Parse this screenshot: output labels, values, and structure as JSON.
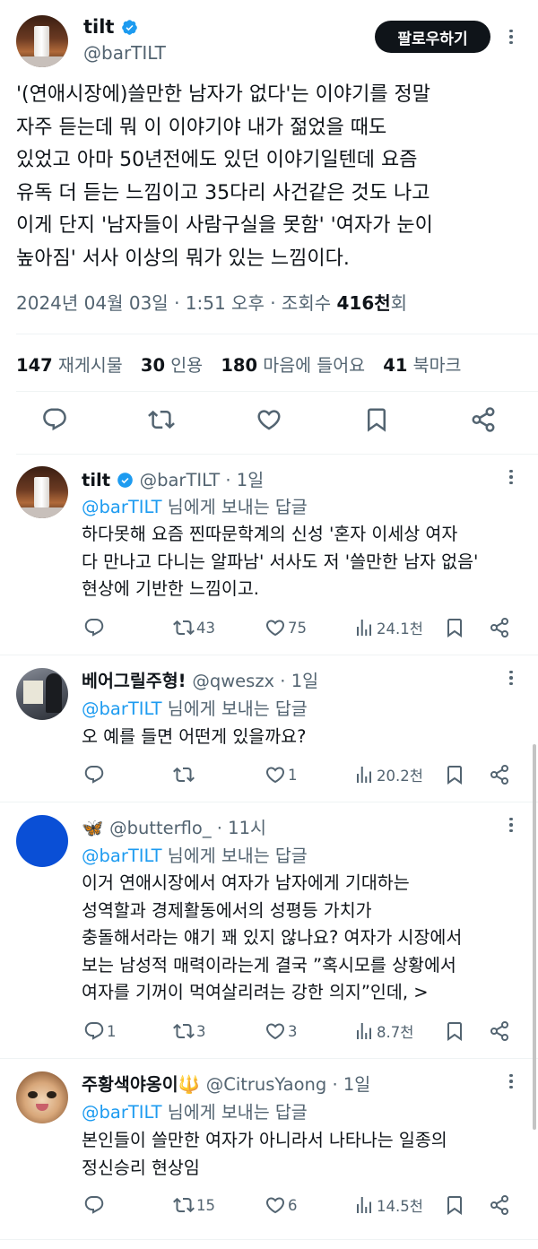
{
  "main_tweet": {
    "display_name": "tilt",
    "handle": "@barTILT",
    "follow_label": "팔로우하기",
    "text_lines": [
      "'(연애시장에)쓸만한 남자가 없다'는 이야기를 정말",
      "자주 듣는데 뭐 이 이야기야 내가 젊었을 때도",
      "있었고 아마 50년전에도 있던 이야기일텐데 요즘",
      "유독 더 듣는 느낌이고 35다리 사건같은 것도 나고",
      "이게 단지 '남자들이 사람구실을 못함' '여자가 눈이",
      "높아짐' 서사 이상의 뭐가 있는 느낌이다."
    ],
    "date": "2024년 04월 03일 · 1:51 오후 · 조회수 ",
    "views": "416천",
    "views_suffix": "회",
    "stats": {
      "retweets": "147",
      "retweets_label": "재게시물",
      "quotes": "30",
      "quotes_label": "인용",
      "likes": "180",
      "likes_label": "마음에 들어요",
      "bookmarks": "41",
      "bookmarks_label": "북마크"
    }
  },
  "replies": [
    {
      "display_name": "tilt",
      "handle_time": "@barTILT · 1일",
      "to_handle": "@barTILT",
      "to_suffix": " 님에게 보내는 답글",
      "text_lines": [
        "하다못해 요즘 찐따문학계의 신성 '혼자 이세상 여자",
        "다 만나고 다니는 알파남' 서사도 저 '쓸만한 남자 없음'",
        "현상에 기반한 느낌이고."
      ],
      "reply_count": "",
      "retweet_count": "43",
      "like_count": "75",
      "view_count": "24.1천"
    },
    {
      "display_name": "베어그릴주형!",
      "handle_time": "@qweszx · 1일",
      "to_handle": "@barTILT",
      "to_suffix": " 님에게 보내는 답글",
      "text_lines": [
        "오 예를 들면 어떤게 있을까요?"
      ],
      "reply_count": "",
      "retweet_count": "",
      "like_count": "1",
      "view_count": "20.2천"
    },
    {
      "display_name": "🦋",
      "handle_time": "@butterflo_ · 11시",
      "to_handle": "@barTILT",
      "to_suffix": " 님에게 보내는 답글",
      "text_lines": [
        "이거 연애시장에서 여자가 남자에게 기대하는",
        "성역할과 경제활동에서의 성평등 가치가",
        "충돌해서라는 얘기 꽤 있지 않나요? 여자가 시장에서",
        "보는 남성적 매력이라는게 결국 ”혹시모를 상황에서",
        "여자를 기꺼이 먹여살리려는 강한 의지”인데, >"
      ],
      "reply_count": "1",
      "retweet_count": "3",
      "like_count": "3",
      "view_count": "8.7천"
    },
    {
      "display_name": "주황색야옹이🔱",
      "handle_time": "@CitrusYaong · 1일",
      "to_handle": "@barTILT",
      "to_suffix": " 님에게 보내는 답글",
      "text_lines": [
        "본인들이 쓸만한 여자가 아니라서 나타나는 일종의",
        "정신승리 현상임"
      ],
      "reply_count": "",
      "retweet_count": "15",
      "like_count": "6",
      "view_count": "14.5천"
    }
  ],
  "colors": {
    "accent": "#1d9bf0",
    "text": "#0f1419",
    "muted": "#536471",
    "divider": "#eff3f4"
  },
  "icons": [
    "verified-badge-icon",
    "more-icon",
    "reply-icon",
    "retweet-icon",
    "like-icon",
    "bookmark-icon",
    "share-icon",
    "views-icon"
  ]
}
